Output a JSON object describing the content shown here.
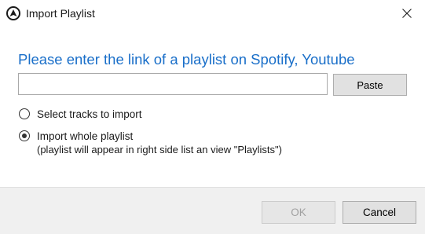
{
  "window": {
    "title": "Import Playlist",
    "icon": "app-logo-icon",
    "close_icon": "close-icon"
  },
  "main": {
    "heading": "Please enter the link of a playlist on Spotify, Youtube",
    "link_input": {
      "value": "",
      "placeholder": ""
    },
    "paste_label": "Paste",
    "options": [
      {
        "label": "Select tracks to import",
        "checked": false
      },
      {
        "label": "Import whole playlist",
        "sublabel": "(playlist will appear in right side list an view \"Playlists\")",
        "checked": true
      }
    ]
  },
  "footer": {
    "ok_label": "OK",
    "ok_enabled": false,
    "cancel_label": "Cancel"
  },
  "colors": {
    "heading": "#1a6fc9",
    "footer_bg": "#f0f0f0"
  }
}
